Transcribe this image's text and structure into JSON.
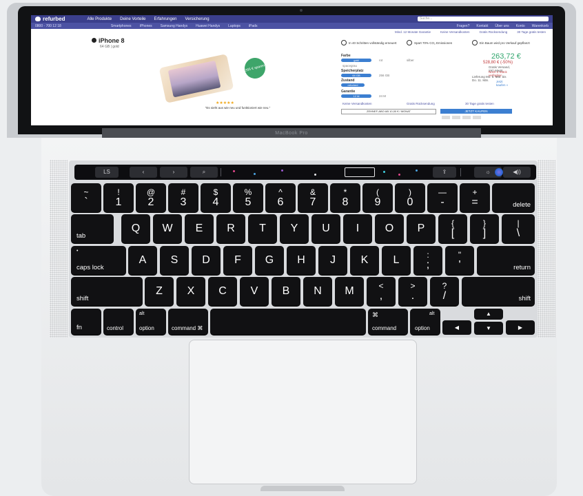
{
  "website": {
    "logo": "refurbed",
    "nav": [
      "Alle Produkte",
      "Deine Vorteile",
      "Erfahrungen",
      "Versicherung"
    ],
    "search_placeholder": "Suche...",
    "subnav_phone": "0800 - 700 12 18",
    "subnav": [
      "Smartphones",
      "iPhones",
      "Samsung Handys",
      "Huawei Handys",
      "Laptops",
      "iPads"
    ],
    "subnav_right": [
      "Fragen?",
      "Kontakt",
      "Über uns",
      "Konto",
      "Warenkorb"
    ],
    "usp_top": [
      "Mind. 12 Monate Garantie",
      "Keine Versandkosten",
      "Gratis Rücksendung",
      "30 Tage gratis testen"
    ],
    "product_title": "iPhone 8",
    "product_subtitle": "64 GB | gold",
    "badge": "265 € sparen",
    "rating_stars": "★★★★★",
    "quote": "\"Es sieht aus wie neu und funktioniert wie neu.\"",
    "features": [
      "In 40 Schritten vollständig erneuert",
      "Spart 70% CO₂ Emissionen",
      "Ein Baum wird pro Verkauf gepflanzt"
    ],
    "options": {
      "farbe_label": "Farbe",
      "farbe_selected": "gold",
      "farbe_alts": [
        "rot",
        "silber",
        "spacegrau"
      ],
      "speicher_label": "Speicherplatz",
      "speicher_selected": "64 GB",
      "speicher_alt": "256 GB",
      "zustand_label": "Zustand",
      "zustand_selected": "refurbed",
      "garantie_label": "Garantie",
      "garantie_selected": "12 M",
      "garantie_alt": "24 M"
    },
    "price": "263,72 €",
    "price_old": "528,80 € (-50%)",
    "price_note": "Gratis Versand, inkl. MwSt.",
    "stock_note": "Noch 4 Stück verfügbar",
    "delivery_note": "Lieferung Mo. 8. Mär. bis Do. 11. Mär.",
    "buy_now_link": "Jetzt kaufen »",
    "buy_button": "JETZT KAUFEN",
    "newsletter": "ZEHNEF-ABO AB 10,00 € / MONAT",
    "usp_bottom": [
      "Keine Versandkosten",
      "Gratis Rücksendung",
      "30 Tage gratis testen"
    ]
  },
  "hinge_label": "MacBook Pro",
  "touchbar": {
    "esc": "LS",
    "back": "‹",
    "forward": "›",
    "search": "⌕",
    "share": "⇪",
    "brightness": "☼",
    "volume": "◀))",
    "mute": "◀×"
  },
  "keys": {
    "row1": [
      {
        "top": "~",
        "bot": "`"
      },
      {
        "top": "!",
        "bot": "1"
      },
      {
        "top": "@",
        "bot": "2"
      },
      {
        "top": "#",
        "bot": "3"
      },
      {
        "top": "$",
        "bot": "4"
      },
      {
        "top": "%",
        "bot": "5"
      },
      {
        "top": "^",
        "bot": "6"
      },
      {
        "top": "&",
        "bot": "7"
      },
      {
        "top": "*",
        "bot": "8"
      },
      {
        "top": "(",
        "bot": "9"
      },
      {
        "top": ")",
        "bot": "0"
      },
      {
        "top": "—",
        "bot": "-"
      },
      {
        "top": "+",
        "bot": "="
      }
    ],
    "delete": "delete",
    "tab": "tab",
    "row2": [
      "Q",
      "W",
      "E",
      "R",
      "T",
      "Y",
      "U",
      "I",
      "O",
      "P"
    ],
    "row2_sym": [
      {
        "top": "{",
        "bot": "["
      },
      {
        "top": "}",
        "bot": "]"
      },
      {
        "top": "|",
        "bot": "\\"
      }
    ],
    "caps": "caps lock",
    "row3": [
      "A",
      "S",
      "D",
      "F",
      "G",
      "H",
      "J",
      "K",
      "L"
    ],
    "row3_sym": [
      {
        "top": ":",
        "bot": ";"
      },
      {
        "top": "\"",
        "bot": "'"
      }
    ],
    "return": "return",
    "shift": "shift",
    "row4": [
      "Z",
      "X",
      "C",
      "V",
      "B",
      "N",
      "M"
    ],
    "row4_sym": [
      {
        "top": "<",
        "bot": ","
      },
      {
        "top": ">",
        "bot": "."
      },
      {
        "top": "?",
        "bot": "/"
      }
    ],
    "fn": "fn",
    "control": "control",
    "alt": "alt",
    "option": "option",
    "command_left": "command ⌘",
    "command_symbol": "⌘",
    "command": "command"
  }
}
